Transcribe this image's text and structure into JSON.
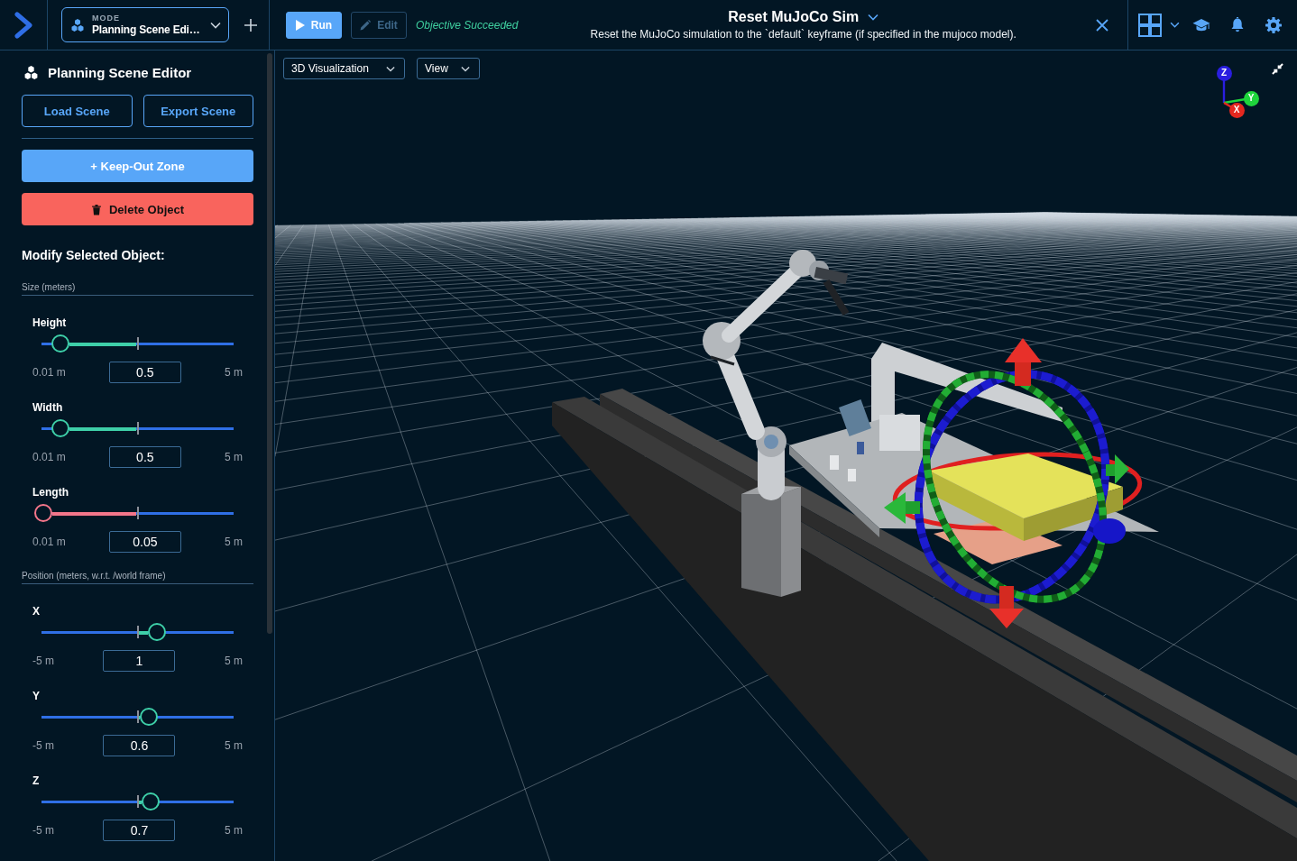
{
  "topbar": {
    "mode": {
      "caption": "MODE",
      "value": "Planning Scene Edi…"
    },
    "actions": [
      {
        "label": "Run",
        "kind": "run",
        "disabled": false
      },
      {
        "label": "Edit",
        "kind": "edit",
        "disabled": true
      }
    ],
    "status": "Objective Succeeded",
    "objective": {
      "title": "Reset MuJoCo Sim",
      "description": "Reset the MuJoCo simulation to the `default` keyframe (if specified in the mujoco model)."
    }
  },
  "sidebar": {
    "title": "Planning Scene Editor",
    "scene_buttons": [
      "Load Scene",
      "Export Scene"
    ],
    "actions": [
      {
        "label": "+ Keep-Out Zone",
        "kind": "add"
      },
      {
        "label": "Delete Object",
        "kind": "delete"
      }
    ],
    "heading": "Modify Selected Object:",
    "groups": [
      {
        "title": "Size (meters)",
        "sliders": [
          {
            "label": "Height",
            "min": "0.01 m",
            "max": "5 m",
            "value": "0.5",
            "level": 0.098,
            "color": "#3ecfa8"
          },
          {
            "label": "Width",
            "min": "0.01 m",
            "max": "5 m",
            "value": "0.5",
            "level": 0.098,
            "color": "#3ecfa8"
          },
          {
            "label": "Length",
            "min": "0.01 m",
            "max": "5 m",
            "value": "0.05",
            "level": 0.008,
            "color": "#f4768a"
          }
        ]
      },
      {
        "title": "Position (meters, w.r.t. /world frame)",
        "sliders": [
          {
            "label": "X",
            "min": "-5 m",
            "max": "5 m",
            "value": "1",
            "level": 0.6,
            "color": "#3ecfa8"
          },
          {
            "label": "Y",
            "min": "-5 m",
            "max": "5 m",
            "value": "0.6",
            "level": 0.56,
            "color": "#3ecfa8"
          },
          {
            "label": "Z",
            "min": "-5 m",
            "max": "5 m",
            "value": "0.7",
            "level": 0.57,
            "color": "#3ecfa8"
          }
        ]
      }
    ]
  },
  "viewport": {
    "panel_select": "3D Visualization",
    "view_select": "View",
    "axes": [
      {
        "label": "Z",
        "color": "#2a1ee0"
      },
      {
        "label": "Y",
        "color": "#1fd43c"
      },
      {
        "label": "X",
        "color": "#e5281f"
      }
    ]
  }
}
